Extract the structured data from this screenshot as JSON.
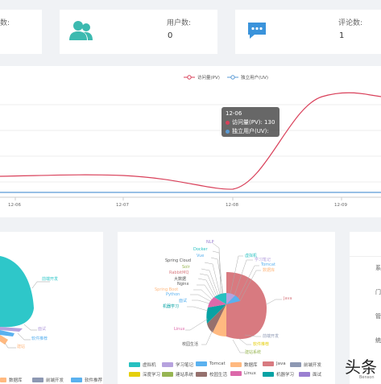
{
  "stats": [
    {
      "label": "数:",
      "value": ""
    },
    {
      "label": "用户数:",
      "value": "0"
    },
    {
      "label": "评论数:",
      "value": "1"
    }
  ],
  "line_chart": {
    "legend": [
      {
        "name": "访问量(PV)",
        "color": "#d9405a"
      },
      {
        "name": "独立用户(UV)",
        "color": "#5b9bd5"
      }
    ],
    "x_ticks": [
      "12-06",
      "12-07",
      "12-08",
      "12-09"
    ],
    "tooltip": {
      "title": "12-06",
      "pv": "访问量(PV): 130",
      "uv": "独立用户(UV): 46"
    }
  },
  "chart_data": {
    "type": "line",
    "x": [
      "12-06",
      "12-07",
      "12-08",
      "12-09"
    ],
    "series": [
      {
        "name": "访问量(PV)",
        "values": [
          130,
          129,
          124,
          300
        ]
      },
      {
        "name": "独立用户(UV)",
        "values": [
          46,
          46,
          46,
          46
        ]
      }
    ]
  },
  "left_pie_labels": [
    "前端开发",
    "面试",
    "软件推荐",
    "建站"
  ],
  "left_legend": [
    "数据库",
    "前端开发",
    "软件推荐"
  ],
  "right_pie_labels": [
    "NLP",
    "Docker",
    "Vue",
    "Spring Cloud",
    "Solr",
    "RabbitMQ",
    "大数据",
    "Nginx",
    "Spring Boot",
    "Python",
    "面试",
    "机器学习",
    "Linux",
    "校园生活",
    "虚拟机",
    "学习笔记",
    "Tomcat",
    "数据库",
    "Java",
    "前端开发",
    "软件推荐",
    "建站系统"
  ],
  "right_legend": [
    {
      "name": "虚拟机",
      "color": "#26c0c0"
    },
    {
      "name": "学习笔记",
      "color": "#b6a2de"
    },
    {
      "name": "Tomcat",
      "color": "#5ab1ef"
    },
    {
      "name": "数据库",
      "color": "#ffb980"
    },
    {
      "name": "Java",
      "color": "#d87a80"
    },
    {
      "name": "前端开发",
      "color": "#8d98b3"
    },
    {
      "name": "深度学习",
      "color": "#e5cf0d"
    },
    {
      "name": "建站系统",
      "color": "#97b552"
    },
    {
      "name": "校园生活",
      "color": "#95706d"
    },
    {
      "name": "Linux",
      "color": "#dc69aa"
    },
    {
      "name": "机器学习",
      "color": "#07a2a4"
    },
    {
      "name": "面试",
      "color": "#9a7fd1"
    }
  ],
  "right_panel_labels": [
    "系",
    "门",
    "管",
    "统"
  ],
  "watermark": "头条",
  "watermark_sub": "Benson"
}
